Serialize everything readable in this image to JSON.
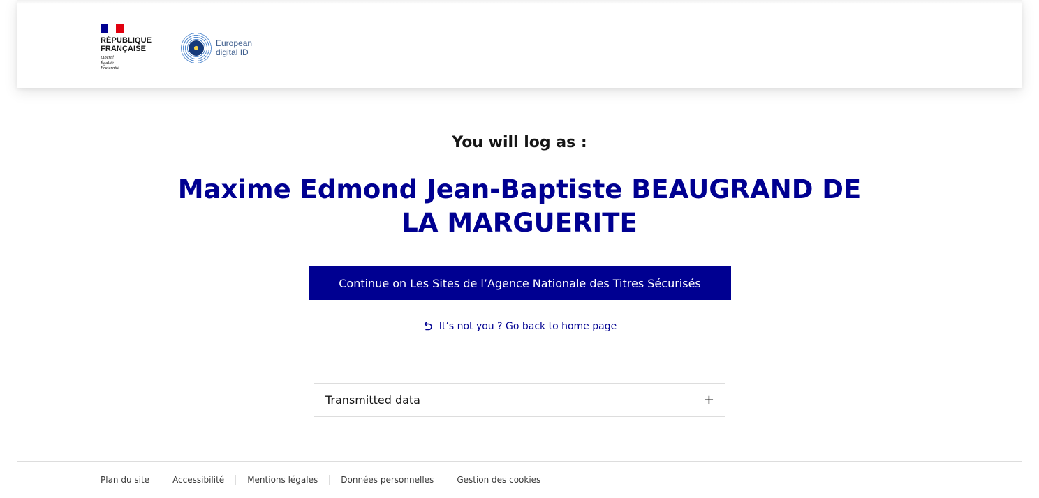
{
  "header": {
    "republique_logo": {
      "name": "RÉPUBLIQUE\nFRANÇAISE",
      "motto": "Liberté\nÉgalité\nFraternité"
    },
    "eudi_logo": {
      "text": "European\ndigital ID",
      "icon": "eu-digital-id-emblem"
    }
  },
  "main": {
    "intro": "You will log as :",
    "user_name": "Maxime Edmond Jean-Baptiste BEAUGRAND DE LA MARGUERITE",
    "continue_label": "Continue on Les Sites de l’Agence Nationale des Titres Sécurisés",
    "back_label": "It’s not you ? Go back to home page",
    "back_icon": "undo-arrow-icon",
    "accordion": {
      "label": "Transmitted data",
      "icon": "plus-icon",
      "expanded": false
    }
  },
  "footer": {
    "links": [
      "Plan du site",
      "Accessibilité",
      "Mentions légales",
      "Données personnelles",
      "Gestion des cookies"
    ]
  },
  "colors": {
    "brand_blue": "#000091",
    "brand_red": "#e1000f"
  }
}
